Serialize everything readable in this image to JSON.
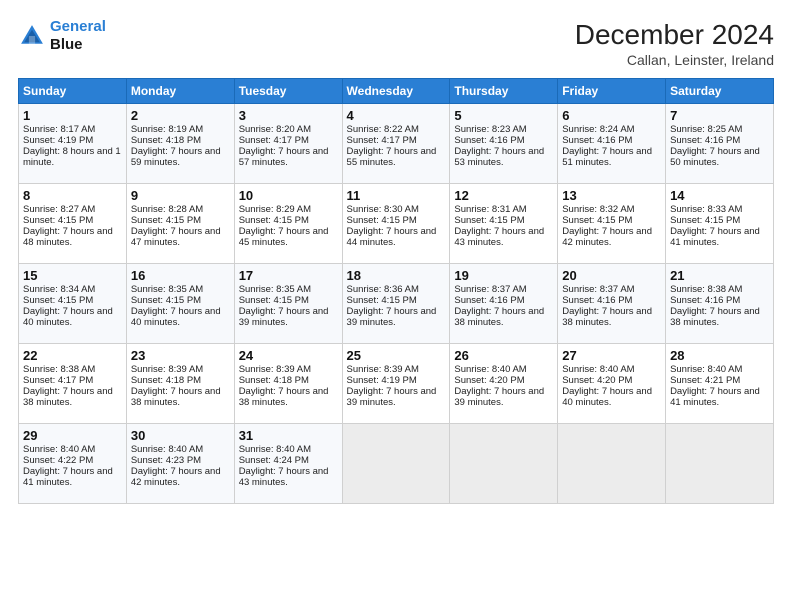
{
  "logo": {
    "line1": "General",
    "line2": "Blue"
  },
  "title": "December 2024",
  "subtitle": "Callan, Leinster, Ireland",
  "header_days": [
    "Sunday",
    "Monday",
    "Tuesday",
    "Wednesday",
    "Thursday",
    "Friday",
    "Saturday"
  ],
  "weeks": [
    [
      {
        "day": "1",
        "sunrise": "Sunrise: 8:17 AM",
        "sunset": "Sunset: 4:19 PM",
        "daylight": "Daylight: 8 hours and 1 minute."
      },
      {
        "day": "2",
        "sunrise": "Sunrise: 8:19 AM",
        "sunset": "Sunset: 4:18 PM",
        "daylight": "Daylight: 7 hours and 59 minutes."
      },
      {
        "day": "3",
        "sunrise": "Sunrise: 8:20 AM",
        "sunset": "Sunset: 4:17 PM",
        "daylight": "Daylight: 7 hours and 57 minutes."
      },
      {
        "day": "4",
        "sunrise": "Sunrise: 8:22 AM",
        "sunset": "Sunset: 4:17 PM",
        "daylight": "Daylight: 7 hours and 55 minutes."
      },
      {
        "day": "5",
        "sunrise": "Sunrise: 8:23 AM",
        "sunset": "Sunset: 4:16 PM",
        "daylight": "Daylight: 7 hours and 53 minutes."
      },
      {
        "day": "6",
        "sunrise": "Sunrise: 8:24 AM",
        "sunset": "Sunset: 4:16 PM",
        "daylight": "Daylight: 7 hours and 51 minutes."
      },
      {
        "day": "7",
        "sunrise": "Sunrise: 8:25 AM",
        "sunset": "Sunset: 4:16 PM",
        "daylight": "Daylight: 7 hours and 50 minutes."
      }
    ],
    [
      {
        "day": "8",
        "sunrise": "Sunrise: 8:27 AM",
        "sunset": "Sunset: 4:15 PM",
        "daylight": "Daylight: 7 hours and 48 minutes."
      },
      {
        "day": "9",
        "sunrise": "Sunrise: 8:28 AM",
        "sunset": "Sunset: 4:15 PM",
        "daylight": "Daylight: 7 hours and 47 minutes."
      },
      {
        "day": "10",
        "sunrise": "Sunrise: 8:29 AM",
        "sunset": "Sunset: 4:15 PM",
        "daylight": "Daylight: 7 hours and 45 minutes."
      },
      {
        "day": "11",
        "sunrise": "Sunrise: 8:30 AM",
        "sunset": "Sunset: 4:15 PM",
        "daylight": "Daylight: 7 hours and 44 minutes."
      },
      {
        "day": "12",
        "sunrise": "Sunrise: 8:31 AM",
        "sunset": "Sunset: 4:15 PM",
        "daylight": "Daylight: 7 hours and 43 minutes."
      },
      {
        "day": "13",
        "sunrise": "Sunrise: 8:32 AM",
        "sunset": "Sunset: 4:15 PM",
        "daylight": "Daylight: 7 hours and 42 minutes."
      },
      {
        "day": "14",
        "sunrise": "Sunrise: 8:33 AM",
        "sunset": "Sunset: 4:15 PM",
        "daylight": "Daylight: 7 hours and 41 minutes."
      }
    ],
    [
      {
        "day": "15",
        "sunrise": "Sunrise: 8:34 AM",
        "sunset": "Sunset: 4:15 PM",
        "daylight": "Daylight: 7 hours and 40 minutes."
      },
      {
        "day": "16",
        "sunrise": "Sunrise: 8:35 AM",
        "sunset": "Sunset: 4:15 PM",
        "daylight": "Daylight: 7 hours and 40 minutes."
      },
      {
        "day": "17",
        "sunrise": "Sunrise: 8:35 AM",
        "sunset": "Sunset: 4:15 PM",
        "daylight": "Daylight: 7 hours and 39 minutes."
      },
      {
        "day": "18",
        "sunrise": "Sunrise: 8:36 AM",
        "sunset": "Sunset: 4:15 PM",
        "daylight": "Daylight: 7 hours and 39 minutes."
      },
      {
        "day": "19",
        "sunrise": "Sunrise: 8:37 AM",
        "sunset": "Sunset: 4:16 PM",
        "daylight": "Daylight: 7 hours and 38 minutes."
      },
      {
        "day": "20",
        "sunrise": "Sunrise: 8:37 AM",
        "sunset": "Sunset: 4:16 PM",
        "daylight": "Daylight: 7 hours and 38 minutes."
      },
      {
        "day": "21",
        "sunrise": "Sunrise: 8:38 AM",
        "sunset": "Sunset: 4:16 PM",
        "daylight": "Daylight: 7 hours and 38 minutes."
      }
    ],
    [
      {
        "day": "22",
        "sunrise": "Sunrise: 8:38 AM",
        "sunset": "Sunset: 4:17 PM",
        "daylight": "Daylight: 7 hours and 38 minutes."
      },
      {
        "day": "23",
        "sunrise": "Sunrise: 8:39 AM",
        "sunset": "Sunset: 4:18 PM",
        "daylight": "Daylight: 7 hours and 38 minutes."
      },
      {
        "day": "24",
        "sunrise": "Sunrise: 8:39 AM",
        "sunset": "Sunset: 4:18 PM",
        "daylight": "Daylight: 7 hours and 38 minutes."
      },
      {
        "day": "25",
        "sunrise": "Sunrise: 8:39 AM",
        "sunset": "Sunset: 4:19 PM",
        "daylight": "Daylight: 7 hours and 39 minutes."
      },
      {
        "day": "26",
        "sunrise": "Sunrise: 8:40 AM",
        "sunset": "Sunset: 4:20 PM",
        "daylight": "Daylight: 7 hours and 39 minutes."
      },
      {
        "day": "27",
        "sunrise": "Sunrise: 8:40 AM",
        "sunset": "Sunset: 4:20 PM",
        "daylight": "Daylight: 7 hours and 40 minutes."
      },
      {
        "day": "28",
        "sunrise": "Sunrise: 8:40 AM",
        "sunset": "Sunset: 4:21 PM",
        "daylight": "Daylight: 7 hours and 41 minutes."
      }
    ],
    [
      {
        "day": "29",
        "sunrise": "Sunrise: 8:40 AM",
        "sunset": "Sunset: 4:22 PM",
        "daylight": "Daylight: 7 hours and 41 minutes."
      },
      {
        "day": "30",
        "sunrise": "Sunrise: 8:40 AM",
        "sunset": "Sunset: 4:23 PM",
        "daylight": "Daylight: 7 hours and 42 minutes."
      },
      {
        "day": "31",
        "sunrise": "Sunrise: 8:40 AM",
        "sunset": "Sunset: 4:24 PM",
        "daylight": "Daylight: 7 hours and 43 minutes."
      },
      null,
      null,
      null,
      null
    ]
  ]
}
